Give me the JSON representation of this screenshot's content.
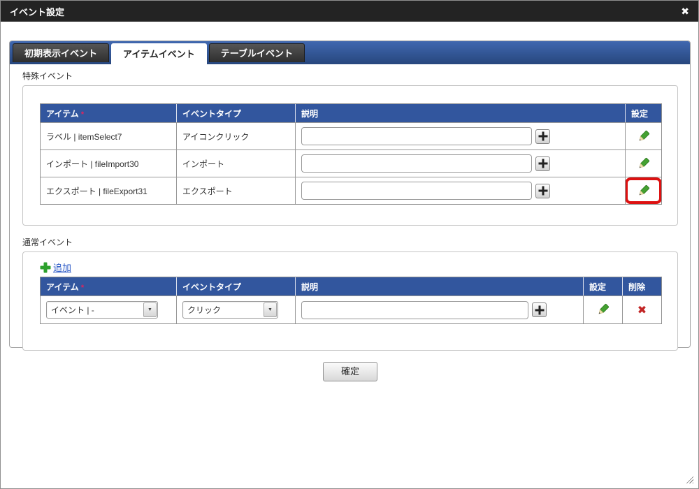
{
  "dialog": {
    "title": "イベント設定",
    "close_icon": "✖"
  },
  "tabs": [
    {
      "label": "初期表示イベント",
      "active": false
    },
    {
      "label": "アイテムイベント",
      "active": true
    },
    {
      "label": "テーブルイベント",
      "active": false
    }
  ],
  "special_events": {
    "section_label": "特殊イベント",
    "columns": {
      "item": "アイテム",
      "required_mark": "*",
      "event_type": "イベントタイプ",
      "description": "説明",
      "settings": "設定"
    },
    "rows": [
      {
        "item": "ラベル | itemSelect7",
        "event_type": "アイコンクリック",
        "description_value": ""
      },
      {
        "item": "インポート | fileImport30",
        "event_type": "インポート",
        "description_value": ""
      },
      {
        "item": "エクスポート | fileExport31",
        "event_type": "エクスポート",
        "description_value": ""
      }
    ]
  },
  "normal_events": {
    "section_label": "通常イベント",
    "add_label": "追加",
    "columns": {
      "item": "アイテム",
      "required_mark": "*",
      "event_type": "イベントタイプ",
      "description": "説明",
      "settings": "設定",
      "delete": "削除"
    },
    "rows": [
      {
        "item_selected": "イベント | -",
        "event_type_selected": "クリック",
        "description_value": ""
      }
    ]
  },
  "footer": {
    "confirm_label": "確定"
  },
  "icons": {
    "dropdown_arrow": "▼",
    "delete_glyph": "✖"
  },
  "colors": {
    "header_blue": "#32569e",
    "tab_bar_top": "#4068b0",
    "tab_bar_bottom": "#27477d",
    "pencil_green": "#44a131",
    "delete_red": "#c22525",
    "highlight_red": "#dd1111",
    "link_blue": "#2353c4"
  }
}
